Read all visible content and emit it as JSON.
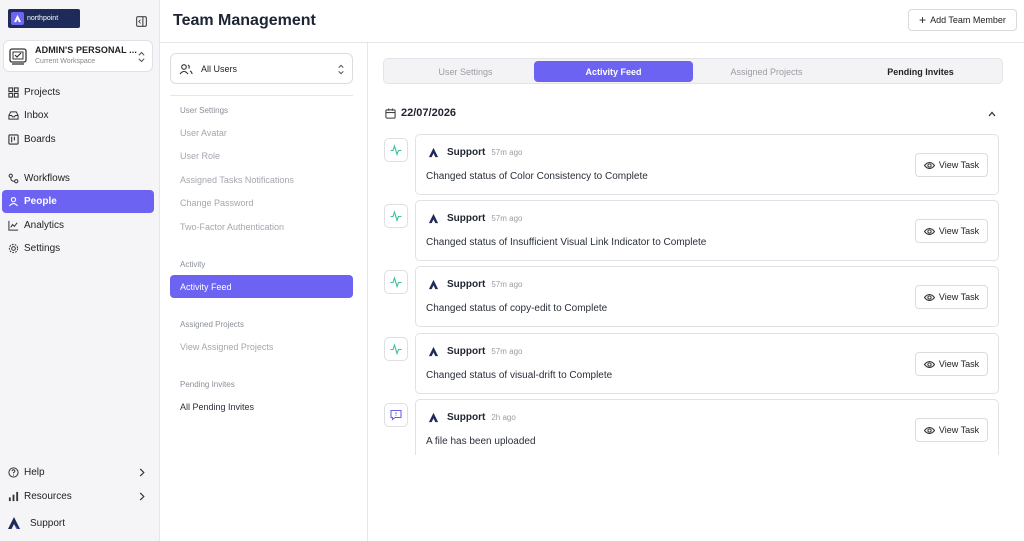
{
  "brand": {
    "name": "northpoint",
    "tagline": "",
    "color": "#1e2a5a",
    "accent": "#6c63f2"
  },
  "workspace": {
    "name": "ADMIN'S PERSONAL ...",
    "subtitle": "Current Workspace"
  },
  "sidebar": {
    "items": [
      {
        "label": "Projects",
        "icon": "grid-icon"
      },
      {
        "label": "Inbox",
        "icon": "inbox-icon"
      },
      {
        "label": "Boards",
        "icon": "board-icon"
      },
      {
        "label": "Workflows",
        "icon": "workflow-icon"
      },
      {
        "label": "People",
        "icon": "person-icon",
        "active": true
      },
      {
        "label": "Analytics",
        "icon": "chart-icon"
      },
      {
        "label": "Settings",
        "icon": "gear-icon"
      }
    ],
    "bottom": [
      {
        "label": "Help",
        "icon": "help-icon"
      },
      {
        "label": "Resources",
        "icon": "bars-icon"
      }
    ],
    "user": {
      "name": "Support"
    }
  },
  "header": {
    "title": "Team Management",
    "add_button": "Add Team Member"
  },
  "panel": {
    "user_filter": "All Users",
    "sections": {
      "user_settings": {
        "label": "User Settings",
        "items": [
          "User Avatar",
          "User Role",
          "Assigned Tasks Notifications",
          "Change Password",
          "Two-Factor Authentication"
        ]
      },
      "activity": {
        "label": "Activity",
        "items": [
          "Activity Feed"
        ]
      },
      "assigned_projects": {
        "label": "Assigned Projects",
        "items": [
          "View Assigned Projects"
        ]
      },
      "pending_invites": {
        "label": "Pending Invites",
        "items": [
          "All Pending Invites"
        ]
      }
    }
  },
  "tabs": [
    "User Settings",
    "Activity Feed",
    "Assigned Projects",
    "Pending Invites"
  ],
  "active_tab": "Activity Feed",
  "feed": {
    "date": "22/07/2026",
    "entries": [
      {
        "user": "Support",
        "time": "57m ago",
        "message": "Changed status of Color Consistency to Complete",
        "action": "View Task",
        "type": "activity"
      },
      {
        "user": "Support",
        "time": "57m ago",
        "message": "Changed status of Insufficient Visual Link Indicator to Complete",
        "action": "View Task",
        "type": "activity"
      },
      {
        "user": "Support",
        "time": "57m ago",
        "message": "Changed status of copy-edit to Complete",
        "action": "View Task",
        "type": "activity"
      },
      {
        "user": "Support",
        "time": "57m ago",
        "message": "Changed status of visual-drift to Complete",
        "action": "View Task",
        "type": "activity"
      },
      {
        "user": "Support",
        "time": "2h ago",
        "message": "A file has been uploaded",
        "action": "View Task",
        "type": "comment"
      }
    ]
  },
  "colors": {
    "activity_icon": "#3cc0a0",
    "comment_icon": "#6c63f2"
  }
}
